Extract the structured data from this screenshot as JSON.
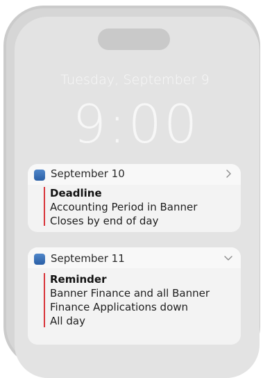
{
  "lockscreen": {
    "date": "Tuesday, September 9",
    "time": "9:00"
  },
  "notifications": [
    {
      "date": "September 10",
      "chevron": "chevron-right-icon",
      "title": "Deadline",
      "lines": [
        "Accounting Period in Banner",
        "Closes by end of day"
      ]
    },
    {
      "date": "September 11",
      "chevron": "chevron-down-icon",
      "title": "Reminder",
      "lines": [
        "Banner Finance and all Banner",
        "Finance Applications down",
        "All day"
      ]
    }
  ],
  "colors": {
    "accent_bar": "#d8343a",
    "app_icon": "#3a6fb5"
  }
}
